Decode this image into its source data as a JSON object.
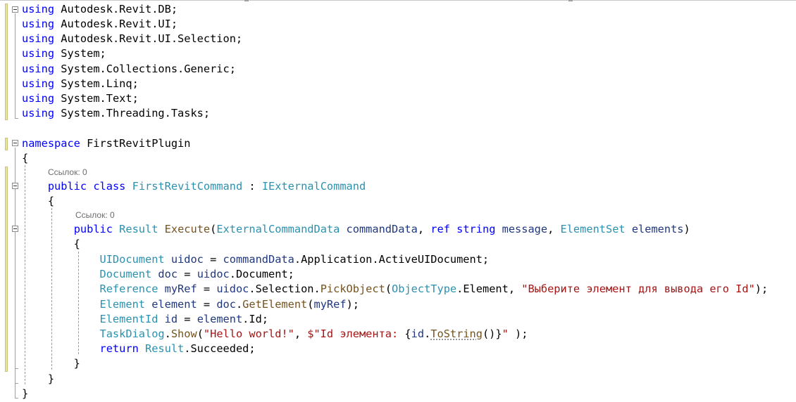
{
  "colors": {
    "keyword": "#0000ff",
    "type": "#2b91af",
    "method": "#74531f",
    "string": "#a31515",
    "identifier": "#1f377f",
    "plain": "#000000",
    "lens": "#6d6d6d"
  },
  "editor": {
    "lines": [
      [
        {
          "t": "using",
          "c": "keyword"
        },
        {
          "t": " Autodesk.Revit.DB;",
          "c": "plain"
        }
      ],
      [
        {
          "t": "using",
          "c": "keyword"
        },
        {
          "t": " Autodesk.Revit.UI;",
          "c": "plain"
        }
      ],
      [
        {
          "t": "using",
          "c": "keyword"
        },
        {
          "t": " Autodesk.Revit.UI.Selection;",
          "c": "plain"
        }
      ],
      [
        {
          "t": "using",
          "c": "keyword"
        },
        {
          "t": " System;",
          "c": "plain"
        }
      ],
      [
        {
          "t": "using",
          "c": "keyword"
        },
        {
          "t": " System.Collections.Generic;",
          "c": "plain"
        }
      ],
      [
        {
          "t": "using",
          "c": "keyword"
        },
        {
          "t": " System.Linq;",
          "c": "plain"
        }
      ],
      [
        {
          "t": "using",
          "c": "keyword"
        },
        {
          "t": " System.Text;",
          "c": "plain"
        }
      ],
      [
        {
          "t": "using",
          "c": "keyword"
        },
        {
          "t": " System.Threading.Tasks;",
          "c": "plain"
        }
      ],
      [],
      [
        {
          "t": "namespace",
          "c": "keyword"
        },
        {
          "t": " FirstRevitPlugin",
          "c": "plain"
        }
      ],
      [
        {
          "t": "{",
          "c": "plain"
        }
      ],
      [
        {
          "t": "    ",
          "c": "plain"
        },
        {
          "t": "public",
          "c": "keyword"
        },
        {
          "t": " ",
          "c": "plain"
        },
        {
          "t": "class",
          "c": "keyword"
        },
        {
          "t": " ",
          "c": "plain"
        },
        {
          "t": "FirstRevitCommand",
          "c": "type"
        },
        {
          "t": " : ",
          "c": "plain"
        },
        {
          "t": "IExternalCommand",
          "c": "type"
        }
      ],
      [
        {
          "t": "    {",
          "c": "plain"
        }
      ],
      [
        {
          "t": "        ",
          "c": "plain"
        },
        {
          "t": "public",
          "c": "keyword"
        },
        {
          "t": " ",
          "c": "plain"
        },
        {
          "t": "Result",
          "c": "type"
        },
        {
          "t": " ",
          "c": "plain"
        },
        {
          "t": "Execute",
          "c": "method"
        },
        {
          "t": "(",
          "c": "plain"
        },
        {
          "t": "ExternalCommandData",
          "c": "type"
        },
        {
          "t": " ",
          "c": "plain"
        },
        {
          "t": "commandData",
          "c": "identifier"
        },
        {
          "t": ", ",
          "c": "plain"
        },
        {
          "t": "ref",
          "c": "keyword"
        },
        {
          "t": " ",
          "c": "plain"
        },
        {
          "t": "string",
          "c": "keyword"
        },
        {
          "t": " ",
          "c": "plain"
        },
        {
          "t": "message",
          "c": "identifier"
        },
        {
          "t": ", ",
          "c": "plain"
        },
        {
          "t": "ElementSet",
          "c": "type"
        },
        {
          "t": " ",
          "c": "plain"
        },
        {
          "t": "elements",
          "c": "identifier"
        },
        {
          "t": ")",
          "c": "plain"
        }
      ],
      [
        {
          "t": "        {",
          "c": "plain"
        }
      ],
      [
        {
          "t": "            ",
          "c": "plain"
        },
        {
          "t": "UIDocument",
          "c": "type"
        },
        {
          "t": " ",
          "c": "plain"
        },
        {
          "t": "uidoc",
          "c": "identifier"
        },
        {
          "t": " = ",
          "c": "plain"
        },
        {
          "t": "commandData",
          "c": "identifier"
        },
        {
          "t": ".Application.ActiveUIDocument;",
          "c": "plain"
        }
      ],
      [
        {
          "t": "            ",
          "c": "plain"
        },
        {
          "t": "Document",
          "c": "type"
        },
        {
          "t": " ",
          "c": "plain"
        },
        {
          "t": "doc",
          "c": "identifier"
        },
        {
          "t": " = ",
          "c": "plain"
        },
        {
          "t": "uidoc",
          "c": "identifier"
        },
        {
          "t": ".Document;",
          "c": "plain"
        }
      ],
      [
        {
          "t": "            ",
          "c": "plain"
        },
        {
          "t": "Reference",
          "c": "type"
        },
        {
          "t": " ",
          "c": "plain"
        },
        {
          "t": "myRef",
          "c": "identifier"
        },
        {
          "t": " = ",
          "c": "plain"
        },
        {
          "t": "uidoc",
          "c": "identifier"
        },
        {
          "t": ".Selection.",
          "c": "plain"
        },
        {
          "t": "PickObject",
          "c": "method"
        },
        {
          "t": "(",
          "c": "plain"
        },
        {
          "t": "ObjectType",
          "c": "type"
        },
        {
          "t": ".Element, ",
          "c": "plain"
        },
        {
          "t": "\"Выберите элемент для вывода его Id\"",
          "c": "string"
        },
        {
          "t": ");",
          "c": "plain"
        }
      ],
      [
        {
          "t": "            ",
          "c": "plain"
        },
        {
          "t": "Element",
          "c": "type"
        },
        {
          "t": " ",
          "c": "plain"
        },
        {
          "t": "element",
          "c": "identifier"
        },
        {
          "t": " = ",
          "c": "plain"
        },
        {
          "t": "doc",
          "c": "identifier"
        },
        {
          "t": ".",
          "c": "plain"
        },
        {
          "t": "GetElement",
          "c": "method"
        },
        {
          "t": "(",
          "c": "plain"
        },
        {
          "t": "myRef",
          "c": "identifier"
        },
        {
          "t": ");",
          "c": "plain"
        }
      ],
      [
        {
          "t": "            ",
          "c": "plain"
        },
        {
          "t": "ElementId",
          "c": "type"
        },
        {
          "t": " ",
          "c": "plain"
        },
        {
          "t": "id",
          "c": "identifier"
        },
        {
          "t": " = ",
          "c": "plain"
        },
        {
          "t": "element",
          "c": "identifier"
        },
        {
          "t": ".Id;",
          "c": "plain"
        }
      ],
      [
        {
          "t": "            ",
          "c": "plain"
        },
        {
          "t": "TaskDialog",
          "c": "type"
        },
        {
          "t": ".",
          "c": "plain"
        },
        {
          "t": "Show",
          "c": "method"
        },
        {
          "t": "(",
          "c": "plain"
        },
        {
          "t": "\"Hello world!\"",
          "c": "string"
        },
        {
          "t": ", ",
          "c": "plain"
        },
        {
          "t": "$\"Id элемента: ",
          "c": "string"
        },
        {
          "t": "{",
          "c": "plain"
        },
        {
          "t": "id",
          "c": "identifier"
        },
        {
          "t": ".",
          "c": "plain"
        },
        {
          "t": "ToString",
          "c": "method",
          "sq": true
        },
        {
          "t": "()",
          "c": "plain"
        },
        {
          "t": "}",
          "c": "plain"
        },
        {
          "t": "\"",
          "c": "string"
        },
        {
          "t": " );",
          "c": "plain"
        }
      ],
      [
        {
          "t": "            ",
          "c": "plain"
        },
        {
          "t": "return",
          "c": "keyword"
        },
        {
          "t": " ",
          "c": "plain"
        },
        {
          "t": "Result",
          "c": "type"
        },
        {
          "t": ".Succeeded;",
          "c": "plain"
        }
      ],
      [
        {
          "t": "        }",
          "c": "plain"
        }
      ],
      [
        {
          "t": "    }",
          "c": "plain"
        }
      ],
      [
        {
          "t": "}",
          "c": "plain"
        }
      ]
    ],
    "lens_labels": [
      "Ссылок: 0",
      "Ссылок: 0"
    ]
  }
}
